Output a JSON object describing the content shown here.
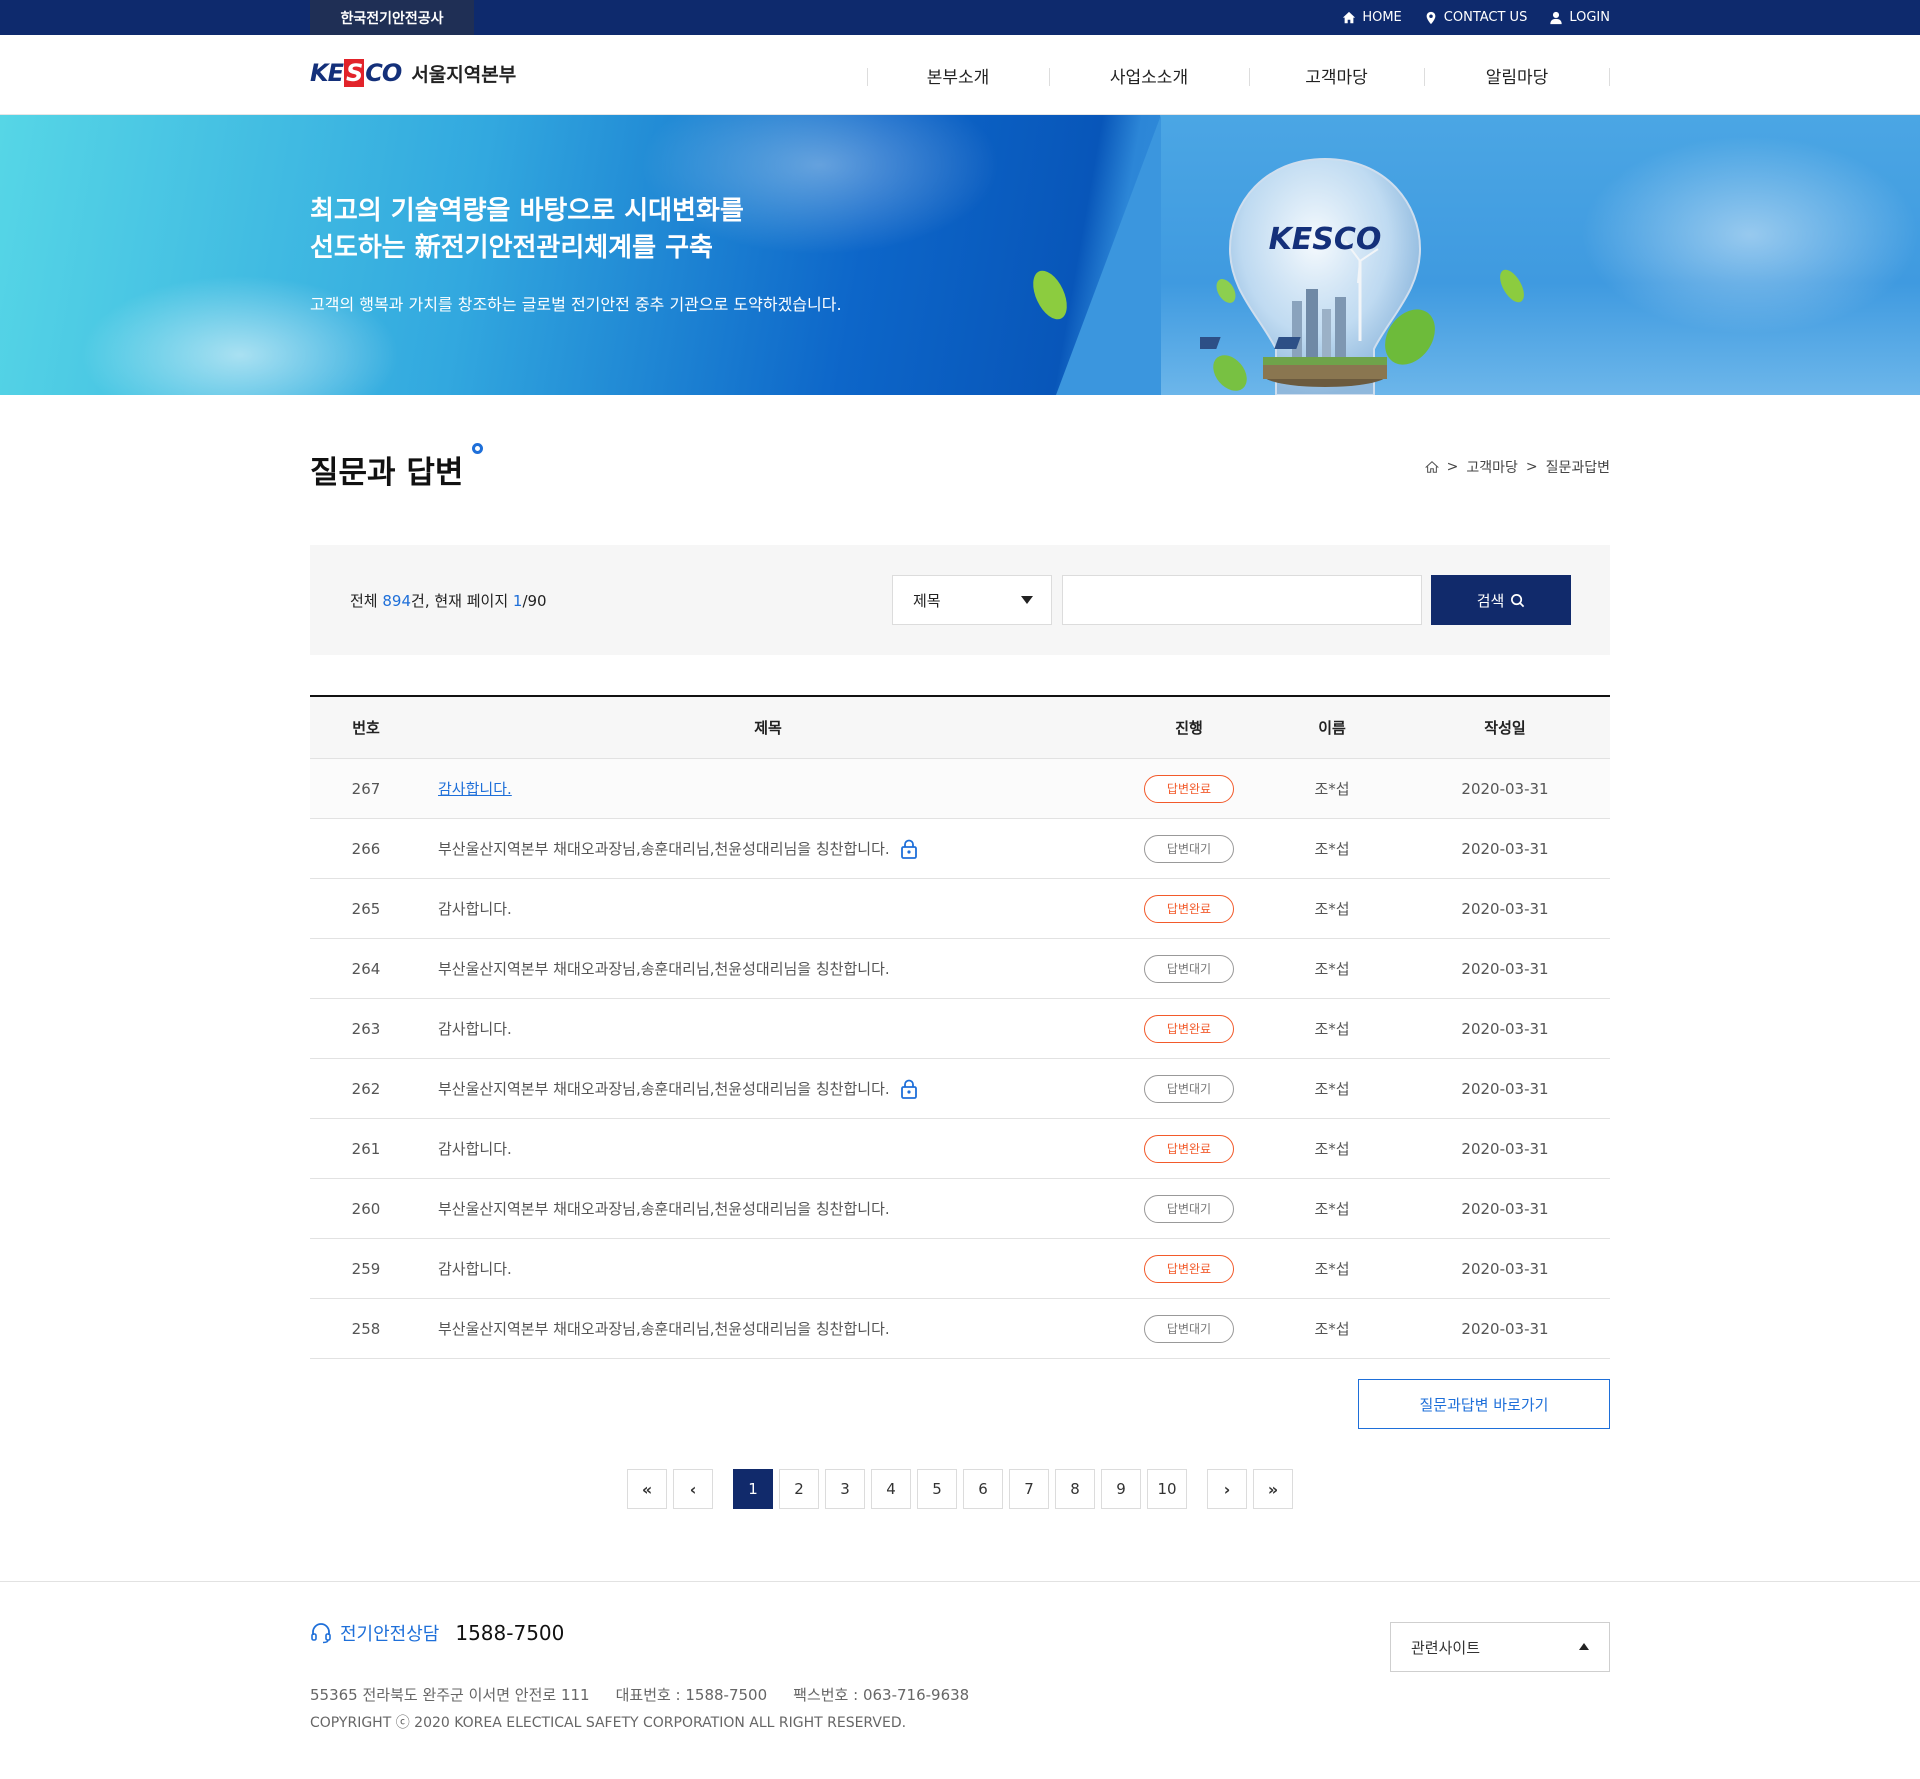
{
  "topbar": {
    "org": "한국전기안전공사",
    "links": [
      {
        "label": "HOME",
        "icon": "home-icon"
      },
      {
        "label": "CONTACT US",
        "icon": "map-pin-icon"
      },
      {
        "label": "LOGIN",
        "icon": "user-icon"
      }
    ]
  },
  "header": {
    "logo_mark_a": "KE",
    "logo_mark_b": "S",
    "logo_mark_c": "CO",
    "logo_text": "서울지역본부",
    "nav": [
      "본부소개",
      "사업소소개",
      "고객마당",
      "알림마당"
    ]
  },
  "banner": {
    "headline_1": "최고의 기술역량을 바탕으로 시대변화를",
    "headline_2": "선도하는 新전기안전관리체계를 구축",
    "subline": "고객의 행복과 가치를 창조하는 글로벌 전기안전 중추 기관으로 도약하겠습니다.",
    "bulb_logo": "KESCO"
  },
  "page": {
    "title": "질문과 답변",
    "breadcrumb": [
      "고객마당",
      "질문과답변"
    ]
  },
  "search": {
    "count_prefix": "전체 ",
    "total": "894",
    "count_mid": "건, 현재 페이지 ",
    "current_page": "1",
    "count_suffix": "/90",
    "field_selected": "제목",
    "input_value": "",
    "button_label": "검색"
  },
  "table": {
    "headers": {
      "no": "번호",
      "title": "제목",
      "status": "진행",
      "name": "이름",
      "date": "작성일"
    },
    "rows": [
      {
        "no": "267",
        "title": "감사합니다.",
        "status": "답변완료",
        "name": "조*섭",
        "date": "2020-03-31"
      },
      {
        "no": "266",
        "title": "부산울산지역본부 채대오과장님,송훈대리님,천윤성대리님을 칭찬합니다.",
        "status": "답변대기",
        "name": "조*섭",
        "date": "2020-03-31"
      },
      {
        "no": "265",
        "title": "감사합니다.",
        "status": "답변완료",
        "name": "조*섭",
        "date": "2020-03-31"
      },
      {
        "no": "264",
        "title": "부산울산지역본부 채대오과장님,송훈대리님,천윤성대리님을 칭찬합니다.",
        "status": "답변대기",
        "name": "조*섭",
        "date": "2020-03-31"
      },
      {
        "no": "263",
        "title": "감사합니다.",
        "status": "답변완료",
        "name": "조*섭",
        "date": "2020-03-31"
      },
      {
        "no": "262",
        "title": "부산울산지역본부 채대오과장님,송훈대리님,천윤성대리님을 칭찬합니다.",
        "status": "답변대기",
        "name": "조*섭",
        "date": "2020-03-31"
      },
      {
        "no": "261",
        "title": "감사합니다.",
        "status": "답변완료",
        "name": "조*섭",
        "date": "2020-03-31"
      },
      {
        "no": "260",
        "title": "부산울산지역본부 채대오과장님,송훈대리님,천윤성대리님을 칭찬합니다.",
        "status": "답변대기",
        "name": "조*섭",
        "date": "2020-03-31"
      },
      {
        "no": "259",
        "title": "감사합니다.",
        "status": "답변완료",
        "name": "조*섭",
        "date": "2020-03-31"
      },
      {
        "no": "258",
        "title": "부산울산지역본부 채대오과장님,송훈대리님,천윤성대리님을 칭찬합니다.",
        "status": "답변대기",
        "name": "조*섭",
        "date": "2020-03-31"
      }
    ]
  },
  "goto_button": "질문과답변 바로가기",
  "pagination": {
    "first": "«",
    "prev": "‹",
    "pages": [
      "1",
      "2",
      "3",
      "4",
      "5",
      "6",
      "7",
      "8",
      "9",
      "10"
    ],
    "next": "›",
    "last": "»"
  },
  "footer": {
    "hotline_label": "전기안전상담",
    "hotline_number": "1588-7500",
    "address": "55365 전라북도 완주군 이서면 안전로 111",
    "phone": "대표번호 : 1588-7500",
    "fax": "팩스번호 : 063-716-9638",
    "copyright": "COPYRIGHT ⓒ 2020 KOREA ELECTICAL SAFETY CORPORATION ALL RIGHT RESERVED.",
    "related_sites": "관련사이트"
  },
  "colors": {
    "navy": "#112a6b",
    "accent_blue": "#1e6fd9",
    "status_done": "#f25a2b",
    "status_wait": "#999999"
  }
}
